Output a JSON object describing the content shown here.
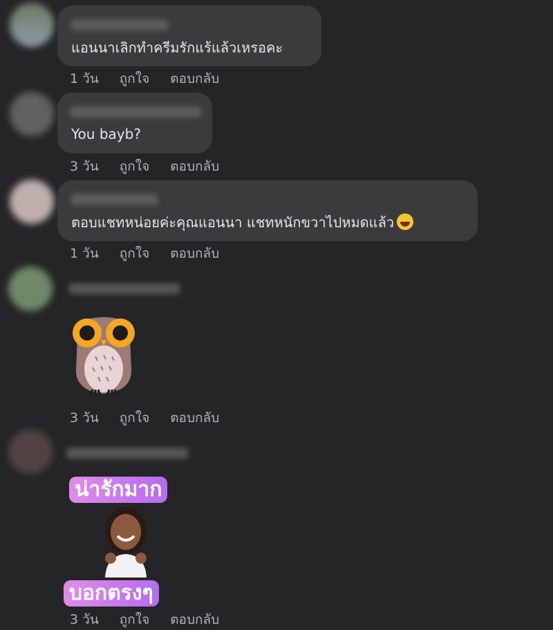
{
  "comments": [
    {
      "text": "แอนนาเลิกทำครีมรักแร้แล้วเหรอคะ",
      "time": "1 วัน",
      "like": "ถูกใจ",
      "reply": "ตอบกลับ"
    },
    {
      "text": "You bayb?",
      "time": "3 วัน",
      "like": "ถูกใจ",
      "reply": "ตอบกลับ"
    },
    {
      "text": "ตอบแชทหน่อยค่ะคุณแอนนา แชทหนักขวาไปหมดแล้ว",
      "time": "1 วัน",
      "like": "ถูกใจ",
      "reply": "ตอบกลับ"
    },
    {
      "sticker": "owl-sticker",
      "time": "3 วัน",
      "like": "ถูกใจ",
      "reply": "ตอบกลับ"
    },
    {
      "sticker": "cute-girl-sticker",
      "sticker_top": "น่ารักมาก",
      "sticker_bottom": "บอกตรงๆ",
      "time": "3 วัน",
      "like": "ถูกใจ",
      "reply": "ตอบกลับ"
    }
  ],
  "colors": {
    "background": "#242526",
    "bubble": "#3a3b3c",
    "text": "#e4e6eb",
    "secondary": "#b0b3b8"
  }
}
